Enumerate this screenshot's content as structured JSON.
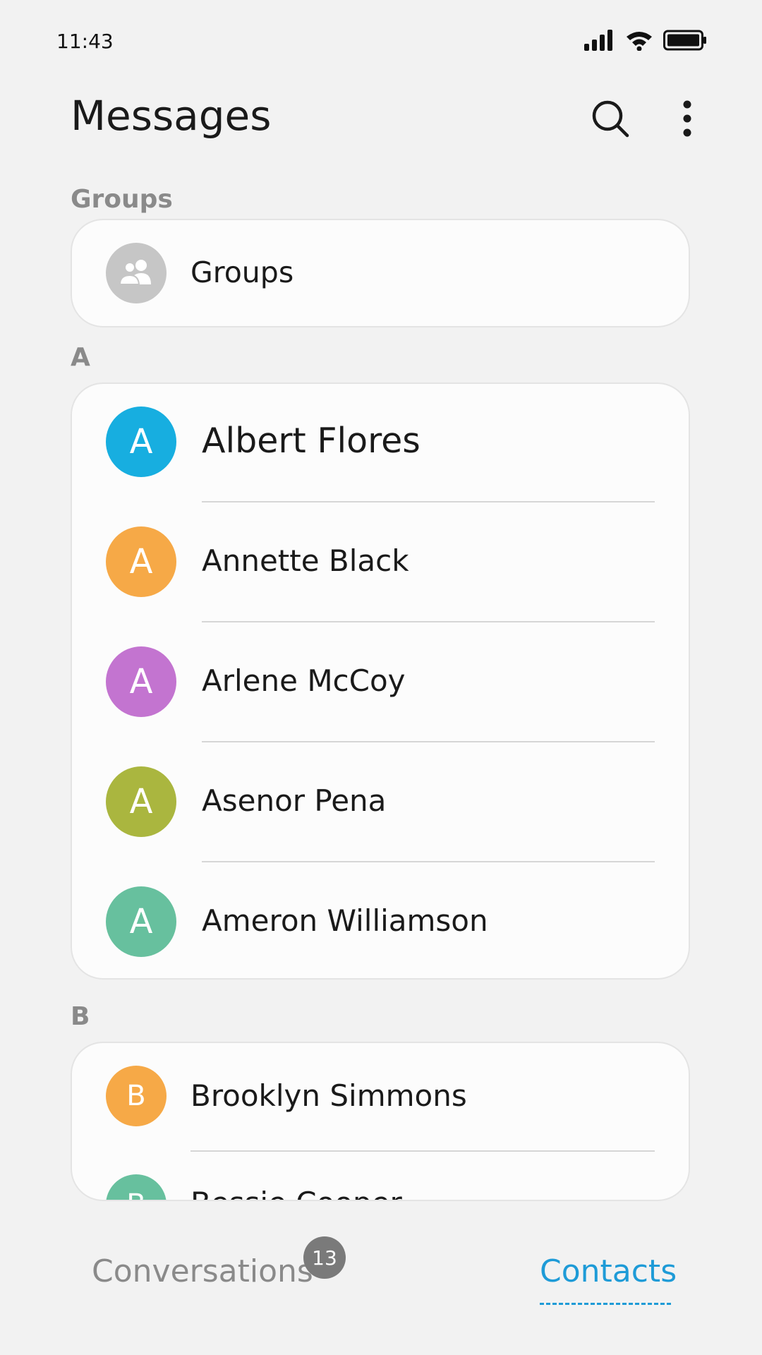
{
  "status_bar": {
    "time": "11:43",
    "icons": [
      "signal-icon",
      "wifi-icon",
      "battery-icon"
    ]
  },
  "header": {
    "title": "Messages",
    "search_icon": "search-icon",
    "more_icon": "more-vertical-icon"
  },
  "sections": {
    "groups_label": "Groups",
    "a_label": "A",
    "b_label": "B"
  },
  "groups_row": {
    "label": "Groups",
    "icon": "people-icon"
  },
  "contacts_a": [
    {
      "initial": "A",
      "name": "Albert Flores",
      "color": "#17aee0"
    },
    {
      "initial": "A",
      "name": "Annette Black",
      "color": "#f6a947"
    },
    {
      "initial": "A",
      "name": "Arlene McCoy",
      "color": "#c374d0"
    },
    {
      "initial": "A",
      "name": "Asenor Pena",
      "color": "#aab63f"
    },
    {
      "initial": "A",
      "name": "Ameron Williamson",
      "color": "#67c09e"
    }
  ],
  "contacts_b": [
    {
      "initial": "B",
      "name": "Brooklyn Simmons",
      "color": "#f6a947"
    },
    {
      "initial": "B",
      "name": "Bessie Cooper",
      "color": "#67c09e"
    }
  ],
  "tabs": {
    "conversations_label": "Conversations",
    "conversations_badge": "13",
    "contacts_label": "Contacts",
    "active_color": "#1e9bd7",
    "inactive_color": "#8a8a8a"
  }
}
